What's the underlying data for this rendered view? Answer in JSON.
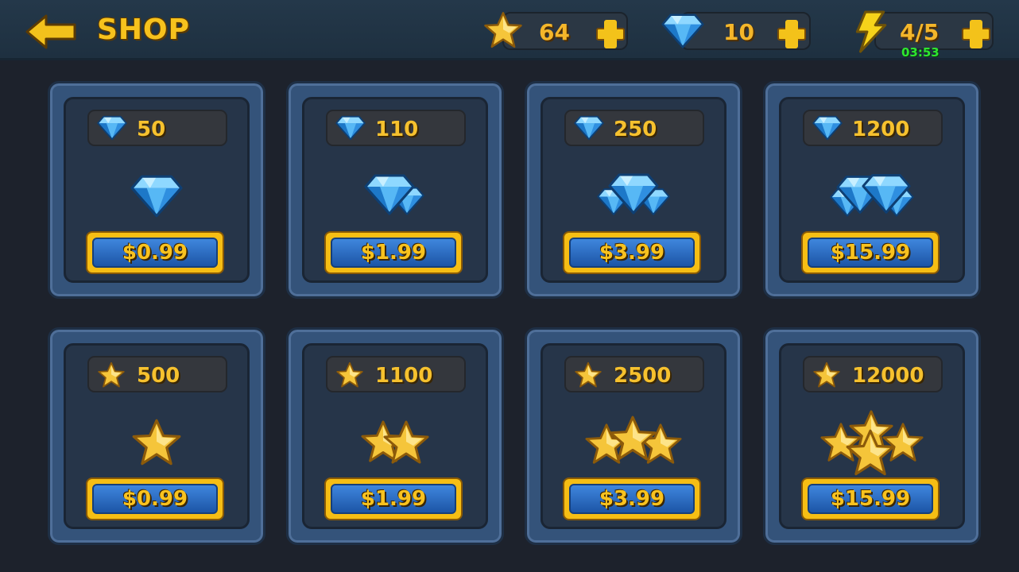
{
  "header": {
    "title": "SHOP",
    "back_icon": "back-arrow-icon",
    "stars": "64",
    "gems": "10",
    "energy": "4/5",
    "energy_timer": "03:53"
  },
  "colors": {
    "accent_gold": "#f6be14",
    "gem_blue": "#3fb4f3",
    "price_button_blue": "#2a6cc4",
    "timer_green": "#2ee630"
  },
  "gem_packs": [
    {
      "amount": "50",
      "price": "$0.99"
    },
    {
      "amount": "110",
      "price": "$1.99"
    },
    {
      "amount": "250",
      "price": "$3.99"
    },
    {
      "amount": "1200",
      "price": "$15.99"
    }
  ],
  "star_packs": [
    {
      "amount": "500",
      "price": "$0.99"
    },
    {
      "amount": "1100",
      "price": "$1.99"
    },
    {
      "amount": "2500",
      "price": "$3.99"
    },
    {
      "amount": "12000",
      "price": "$15.99"
    }
  ]
}
